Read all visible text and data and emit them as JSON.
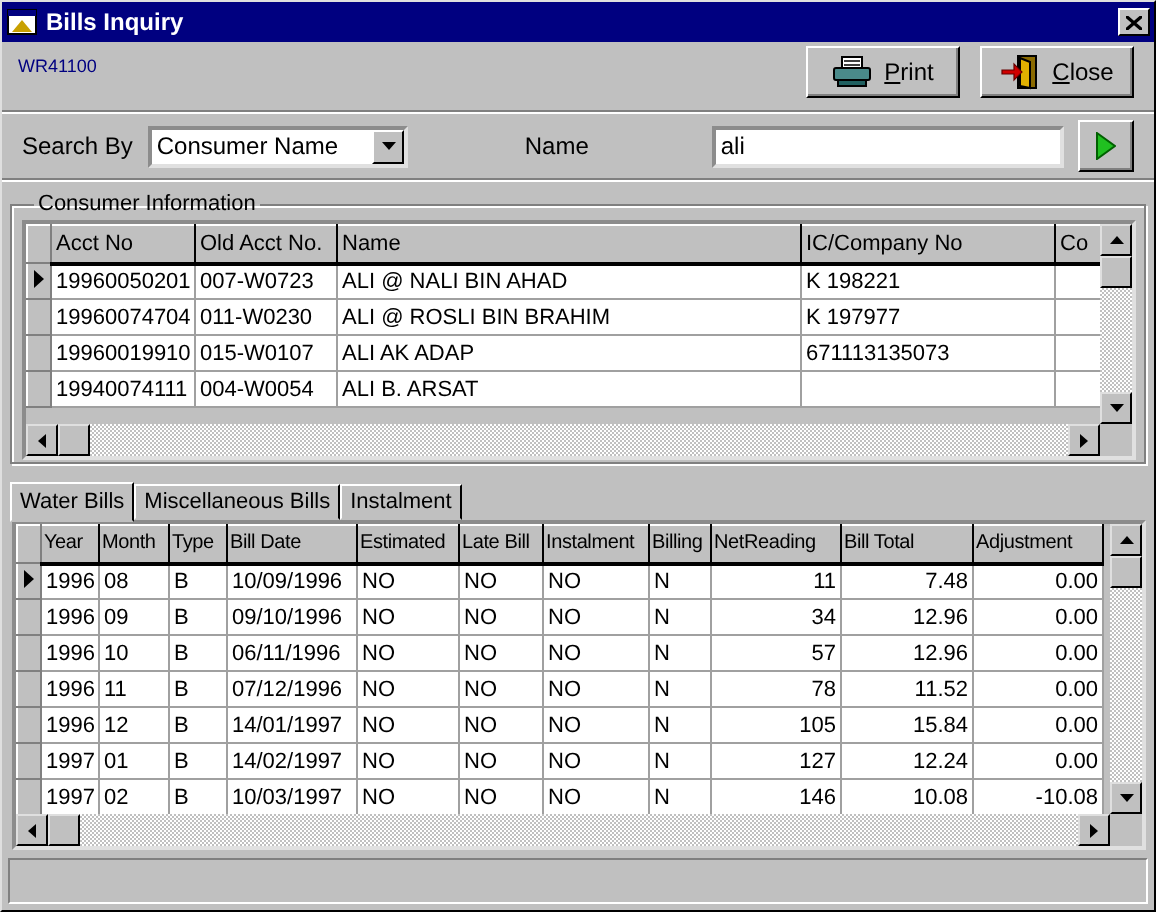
{
  "window": {
    "title": "Bills Inquiry"
  },
  "form_code": "WR41100",
  "buttons": [
    {
      "label": "Print",
      "kind": "print"
    },
    {
      "label": "Close",
      "kind": "close"
    }
  ],
  "search": {
    "label": "Search By",
    "value": "Consumer Name",
    "name_label": "Name",
    "name_value": "ali"
  },
  "consumer_information": {
    "title": "Consumer Information",
    "columns": [
      {
        "label": "Acct No"
      },
      {
        "label": "Old Acct No."
      },
      {
        "label": "Name"
      },
      {
        "label": "IC/Company No"
      },
      {
        "label": "Co"
      }
    ],
    "rows": [
      {
        "selected": true,
        "cells": [
          "19960050201",
          "007-W0723",
          "ALI @ NALI BIN AHAD",
          "K 198221",
          ""
        ]
      },
      {
        "selected": false,
        "cells": [
          "19960074704",
          "011-W0230",
          "ALI @ ROSLI BIN BRAHIM",
          "K 197977",
          ""
        ]
      },
      {
        "selected": false,
        "cells": [
          "19960019910",
          "015-W0107",
          "ALI AK ADAP",
          "671113135073",
          ""
        ]
      },
      {
        "selected": false,
        "cells": [
          "19940074111",
          "004-W0054",
          "ALI B. ARSAT",
          "",
          ""
        ]
      }
    ]
  },
  "tabs": [
    {
      "label": "Water Bills",
      "selected": true
    },
    {
      "label": "Miscellaneous Bills",
      "selected": false
    },
    {
      "label": "Instalment",
      "selected": false
    }
  ],
  "bills_table": {
    "columns": [
      {
        "label": "Year",
        "kind": "text"
      },
      {
        "label": "Month",
        "kind": "text"
      },
      {
        "label": "Type",
        "kind": "text"
      },
      {
        "label": "Bill Date",
        "kind": "text"
      },
      {
        "label": "Estimated",
        "kind": "text"
      },
      {
        "label": "Late Bill",
        "kind": "text"
      },
      {
        "label": "Instalment",
        "kind": "text"
      },
      {
        "label": "Billing",
        "kind": "text"
      },
      {
        "label": "NetReading",
        "kind": "number"
      },
      {
        "label": "Bill Total",
        "kind": "number"
      },
      {
        "label": "Adjustment",
        "kind": "number"
      }
    ],
    "rows": [
      {
        "selected": true,
        "cells": [
          "1996",
          "08",
          "B",
          "10/09/1996",
          "NO",
          "NO",
          "NO",
          "N",
          "11",
          "7.48",
          "0.00"
        ]
      },
      {
        "selected": false,
        "cells": [
          "1996",
          "09",
          "B",
          "09/10/1996",
          "NO",
          "NO",
          "NO",
          "N",
          "34",
          "12.96",
          "0.00"
        ]
      },
      {
        "selected": false,
        "cells": [
          "1996",
          "10",
          "B",
          "06/11/1996",
          "NO",
          "NO",
          "NO",
          "N",
          "57",
          "12.96",
          "0.00"
        ]
      },
      {
        "selected": false,
        "cells": [
          "1996",
          "11",
          "B",
          "07/12/1996",
          "NO",
          "NO",
          "NO",
          "N",
          "78",
          "11.52",
          "0.00"
        ]
      },
      {
        "selected": false,
        "cells": [
          "1996",
          "12",
          "B",
          "14/01/1997",
          "NO",
          "NO",
          "NO",
          "N",
          "105",
          "15.84",
          "0.00"
        ]
      },
      {
        "selected": false,
        "cells": [
          "1997",
          "01",
          "B",
          "14/02/1997",
          "NO",
          "NO",
          "NO",
          "N",
          "127",
          "12.24",
          "0.00"
        ]
      },
      {
        "selected": false,
        "cells": [
          "1997",
          "02",
          "B",
          "10/03/1997",
          "NO",
          "NO",
          "NO",
          "N",
          "146",
          "10.08",
          "-10.08"
        ]
      }
    ]
  }
}
